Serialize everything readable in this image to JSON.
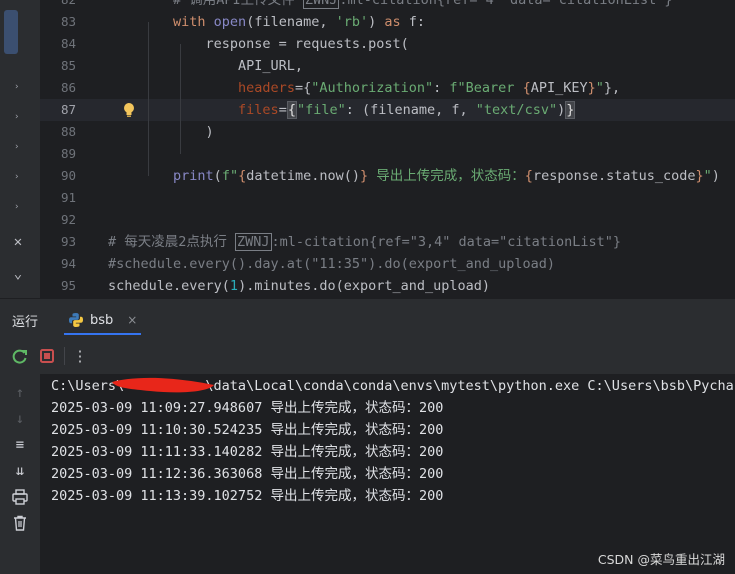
{
  "editor": {
    "lines": [
      {
        "num": "82",
        "tokens": [
          {
            "t": "        "
          },
          {
            "t": "# 调用API上传文件 ",
            "c": "com"
          },
          {
            "t": "ZWNJ",
            "c": "com zwnj-box"
          },
          {
            "t": ":ml-citation{ref=\"4\" data=\"citationList\"}",
            "c": "com"
          }
        ]
      },
      {
        "num": "83",
        "tokens": [
          {
            "t": "        "
          },
          {
            "t": "with ",
            "c": "kw"
          },
          {
            "t": "open",
            "c": "builtin"
          },
          {
            "t": "(filename, "
          },
          {
            "t": "'rb'",
            "c": "str"
          },
          {
            "t": ") "
          },
          {
            "t": "as ",
            "c": "kw"
          },
          {
            "t": "f:"
          }
        ]
      },
      {
        "num": "84",
        "tokens": [
          {
            "t": "            response = requests.post("
          }
        ]
      },
      {
        "num": "85",
        "tokens": [
          {
            "t": "                API_URL,"
          }
        ]
      },
      {
        "num": "86",
        "tokens": [
          {
            "t": "                "
          },
          {
            "t": "headers",
            "c": "param"
          },
          {
            "t": "={"
          },
          {
            "t": "\"Authorization\"",
            "c": "str"
          },
          {
            "t": ": "
          },
          {
            "t": "f\"Bearer ",
            "c": "str"
          },
          {
            "t": "{",
            "c": "brace"
          },
          {
            "t": "API_KEY"
          },
          {
            "t": "}",
            "c": "brace"
          },
          {
            "t": "\"",
            "c": "str"
          },
          {
            "t": "},"
          }
        ]
      },
      {
        "num": "87",
        "current": true,
        "tokens": [
          {
            "t": "                "
          },
          {
            "t": "files",
            "c": "param"
          },
          {
            "t": "="
          },
          {
            "t": "{",
            "c": "match-bracket"
          },
          {
            "t": "\"file\"",
            "c": "str"
          },
          {
            "t": ": (filename, f, "
          },
          {
            "t": "\"text/csv\"",
            "c": "str"
          },
          {
            "t": ")"
          },
          {
            "t": "}",
            "c": "match-bracket"
          }
        ]
      },
      {
        "num": "88",
        "tokens": [
          {
            "t": "            )"
          }
        ]
      },
      {
        "num": "89",
        "tokens": []
      },
      {
        "num": "90",
        "tokens": [
          {
            "t": "        "
          },
          {
            "t": "print",
            "c": "builtin"
          },
          {
            "t": "("
          },
          {
            "t": "f\"",
            "c": "str"
          },
          {
            "t": "{",
            "c": "brace"
          },
          {
            "t": "datetime.now()"
          },
          {
            "t": "}",
            "c": "brace"
          },
          {
            "t": " 导出上传完成，状态码：",
            "c": "str"
          },
          {
            "t": "{",
            "c": "brace"
          },
          {
            "t": "response.status_code"
          },
          {
            "t": "}",
            "c": "brace"
          },
          {
            "t": "\"",
            "c": "str"
          },
          {
            "t": ")"
          }
        ]
      },
      {
        "num": "91",
        "tokens": []
      },
      {
        "num": "92",
        "tokens": []
      },
      {
        "num": "93",
        "tokens": [
          {
            "t": "# 每天凌晨2点执行 ",
            "c": "com"
          },
          {
            "t": "ZWNJ",
            "c": "com zwnj-box"
          },
          {
            "t": ":ml-citation{ref=\"3,4\" data=\"citationList\"}",
            "c": "com"
          }
        ]
      },
      {
        "num": "94",
        "tokens": [
          {
            "t": "#schedule.every().day.at(\"11:35\").do(export_and_upload)",
            "c": "com"
          }
        ]
      },
      {
        "num": "95",
        "tokens": [
          {
            "t": "schedule.every("
          },
          {
            "t": "1",
            "c": "num"
          },
          {
            "t": ").minutes.do(export_and_upload)"
          }
        ]
      }
    ]
  },
  "run": {
    "title": "运行",
    "tab_label": "bsb",
    "tab_close": "×"
  },
  "console": {
    "command": "C:\\Users\\          \\data\\Local\\conda\\conda\\envs\\mytest\\python.exe C:\\Users\\bsb\\PycharmProj",
    "output": [
      "2025-03-09 11:09:27.948607 导出上传完成，状态码：200",
      "2025-03-09 11:10:30.524235 导出上传完成，状态码：200",
      "2025-03-09 11:11:33.140282 导出上传完成，状态码：200",
      "2025-03-09 11:12:36.363068 导出上传完成，状态码：200",
      "2025-03-09 11:13:39.102752 导出上传完成，状态码：200"
    ]
  },
  "watermark": "CSDN @菜鸟重出江湖",
  "colors": {
    "background": "#1e1f22",
    "panel": "#2b2d30",
    "accent": "#3574f0",
    "stop": "#c94f4f",
    "rerun": "#5fb865",
    "redaction": "#e8261a"
  },
  "icons": [
    "rerun-icon",
    "stop-icon",
    "more-icon",
    "arrow-up-icon",
    "arrow-down-icon",
    "soft-wrap-icon",
    "scroll-to-end-icon",
    "print-icon",
    "trash-icon",
    "python-icon",
    "bulb-icon"
  ]
}
